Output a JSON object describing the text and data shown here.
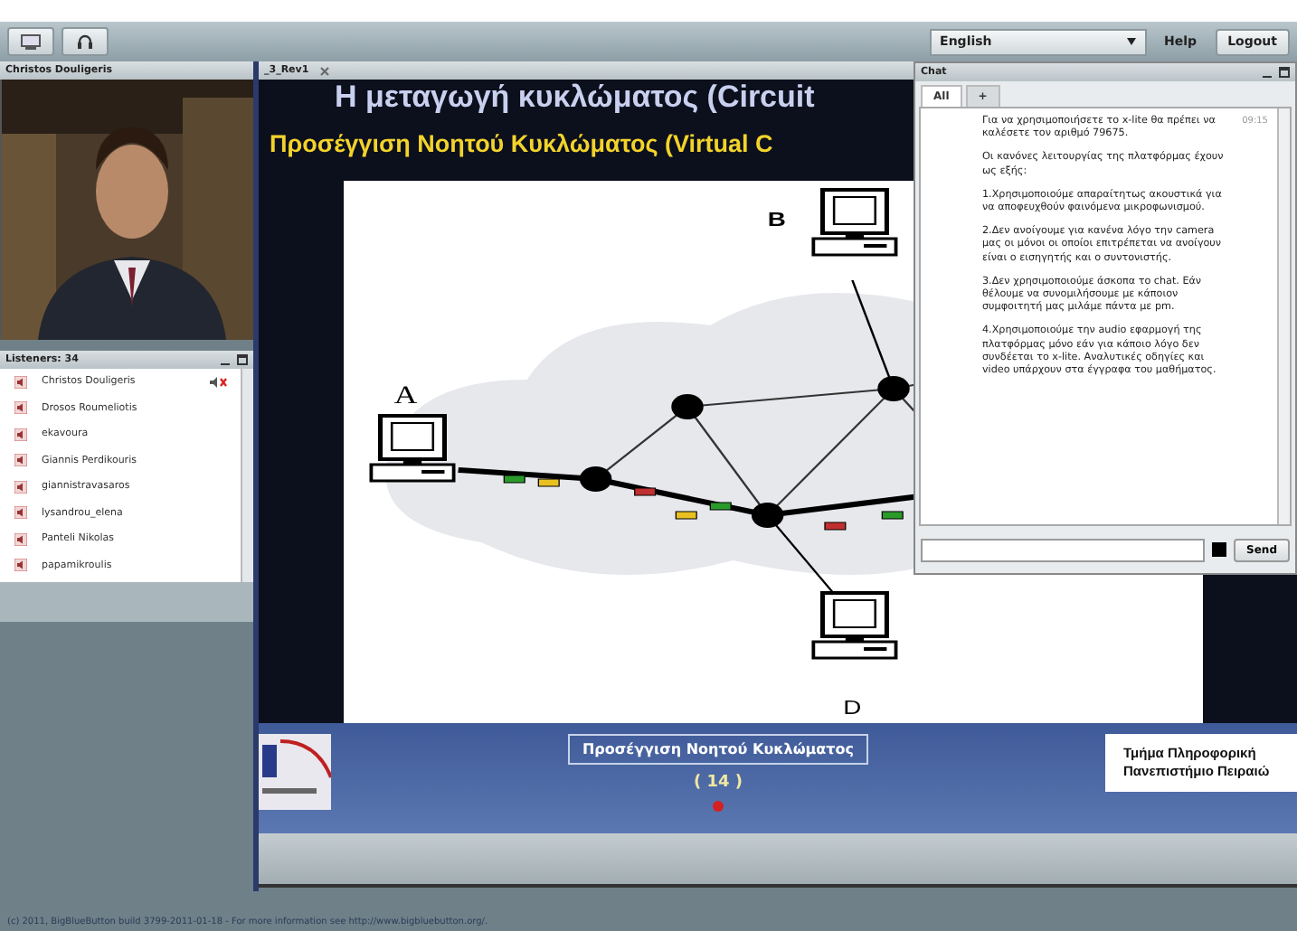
{
  "toolbar": {
    "language": "English",
    "help": "Help",
    "logout": "Logout"
  },
  "video": {
    "title": "Christos Douligeris"
  },
  "listeners": {
    "title": "Listeners: 34",
    "items": [
      {
        "name": "Christos Douligeris",
        "talking": true
      },
      {
        "name": "Drosos Roumeliotis",
        "talking": false
      },
      {
        "name": "ekavoura",
        "talking": false
      },
      {
        "name": "Giannis Perdikouris",
        "talking": false
      },
      {
        "name": "giannistravasaros",
        "talking": false
      },
      {
        "name": "lysandrou_elena",
        "talking": false
      },
      {
        "name": "Panteli Nikolas",
        "talking": false
      },
      {
        "name": "papamikroulis",
        "talking": false
      }
    ]
  },
  "presentation": {
    "tab": "_3_Rev1",
    "title": "Η μεταγωγή κυκλώματος (Circuit",
    "subtitle": "Προσέγγιση Νοητού Κυκλώματος (Virtual C",
    "node_labels": [
      "A",
      "B",
      "D"
    ],
    "caption": "Προσέγγιση Νοητού Κυκλώματος",
    "page": "( 14 )",
    "department": [
      "Τμήμα Πληροφορική",
      "Πανεπιστήμιο Πειραιώ"
    ]
  },
  "chat": {
    "title": "Chat",
    "tabs": [
      {
        "label": "All",
        "selected": true
      },
      {
        "label": "+",
        "selected": false
      }
    ],
    "time": "09:15",
    "paragraphs": [
      "Για να χρησιμοποιήσετε το x-lite θα πρέπει να καλέσετε τον αριθμό 79675.",
      "Οι κανόνες λειτουργίας της πλατφόρμας έχουν ως εξής:",
      "1.Χρησιμοποιούμε απαραίτητως ακουστικά για να αποφευχθούν φαινόμενα μικροφωνισμού.",
      "2.Δεν ανοίγουμε για κανένα λόγο την camera μας οι μόνοι οι οποίοι επιτρέπεται να ανοίγουν είναι ο εισηγητής και ο συντονιστής.",
      "3.Δεν χρησιμοποιούμε άσκοπα το chat. Εάν θέλουμε να συνομιλήσουμε με κάποιον συμφοιτητή μας μιλάμε πάντα με pm.",
      "4.Χρησιμοποιούμε την audio εφαρμογή της πλατφόρμας μόνο εάν για κάποιο λόγο δεν συνδέεται το x-lite. Αναλυτικές οδηγίες και video υπάρχουν στα έγγραφα του μαθήματος."
    ],
    "send": "Send"
  },
  "footer": "(c) 2011, BigBlueButton build 3799-2011-01-18 - For more information see http://www.bigbluebutton.org/."
}
